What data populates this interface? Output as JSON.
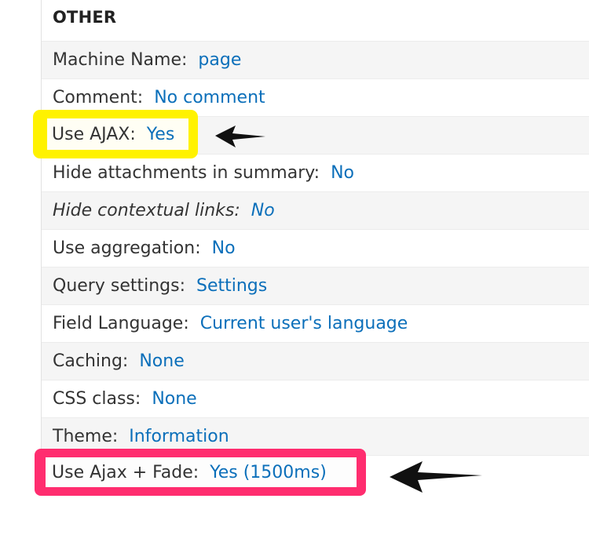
{
  "section": {
    "title": "OTHER"
  },
  "rows": [
    {
      "label": "Machine Name:",
      "value": "page"
    },
    {
      "label": "Comment:",
      "value": "No comment"
    },
    {
      "label": "Use AJAX:",
      "value": "Yes"
    },
    {
      "label": "Hide attachments in summary:",
      "value": "No"
    },
    {
      "label": "Hide contextual links:",
      "value": "No"
    },
    {
      "label": "Use aggregation:",
      "value": "No"
    },
    {
      "label": "Query settings:",
      "value": "Settings"
    },
    {
      "label": "Field Language:",
      "value": "Current user's language"
    },
    {
      "label": "Caching:",
      "value": "None"
    },
    {
      "label": "CSS class:",
      "value": "None"
    },
    {
      "label": "Theme:",
      "value": "Information"
    },
    {
      "label": "Use Ajax + Fade:",
      "value": "Yes (1500ms)"
    }
  ],
  "annotations": {
    "yellow_highlight_color": "#fff200",
    "pink_highlight_color": "#ff2d6f",
    "arrow_icon": "left-arrow-icon"
  },
  "colors": {
    "link": "#0b6fba",
    "label": "#333333",
    "stripe": "#f5f5f5"
  }
}
